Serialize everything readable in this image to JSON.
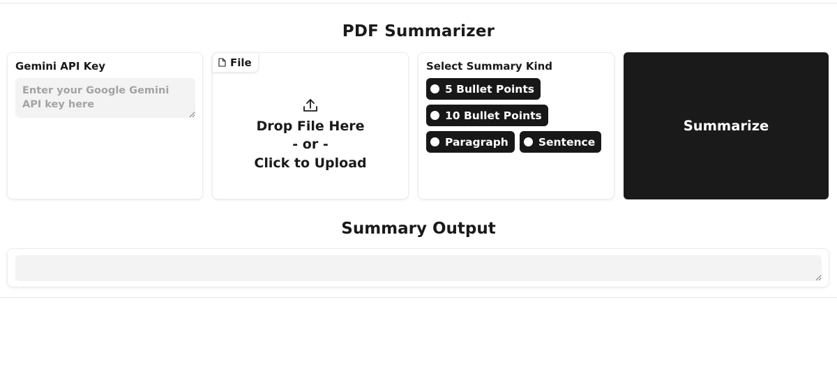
{
  "app": {
    "title": "PDF Summarizer"
  },
  "api_key": {
    "label": "Gemini API Key",
    "value": "",
    "placeholder": "Enter your Google Gemini API key here"
  },
  "file_upload": {
    "tab_label": "File",
    "tab_icon": "file-icon",
    "upload_icon": "upload-arrow-icon",
    "line1": "Drop File Here",
    "line2": "- or -",
    "line3": "Click to Upload"
  },
  "summary_kind": {
    "label": "Select Summary Kind",
    "options": [
      {
        "label": "5 Bullet Points",
        "selected": false
      },
      {
        "label": "10 Bullet Points",
        "selected": false
      },
      {
        "label": "Paragraph",
        "selected": false
      },
      {
        "label": "Sentence",
        "selected": false
      }
    ]
  },
  "actions": {
    "summarize_label": "Summarize"
  },
  "output": {
    "title": "Summary Output",
    "value": ""
  },
  "colors": {
    "accent_dark": "#181818",
    "input_bg": "#f3f3f3",
    "placeholder": "#a3a3a3",
    "border": "#ececec"
  }
}
